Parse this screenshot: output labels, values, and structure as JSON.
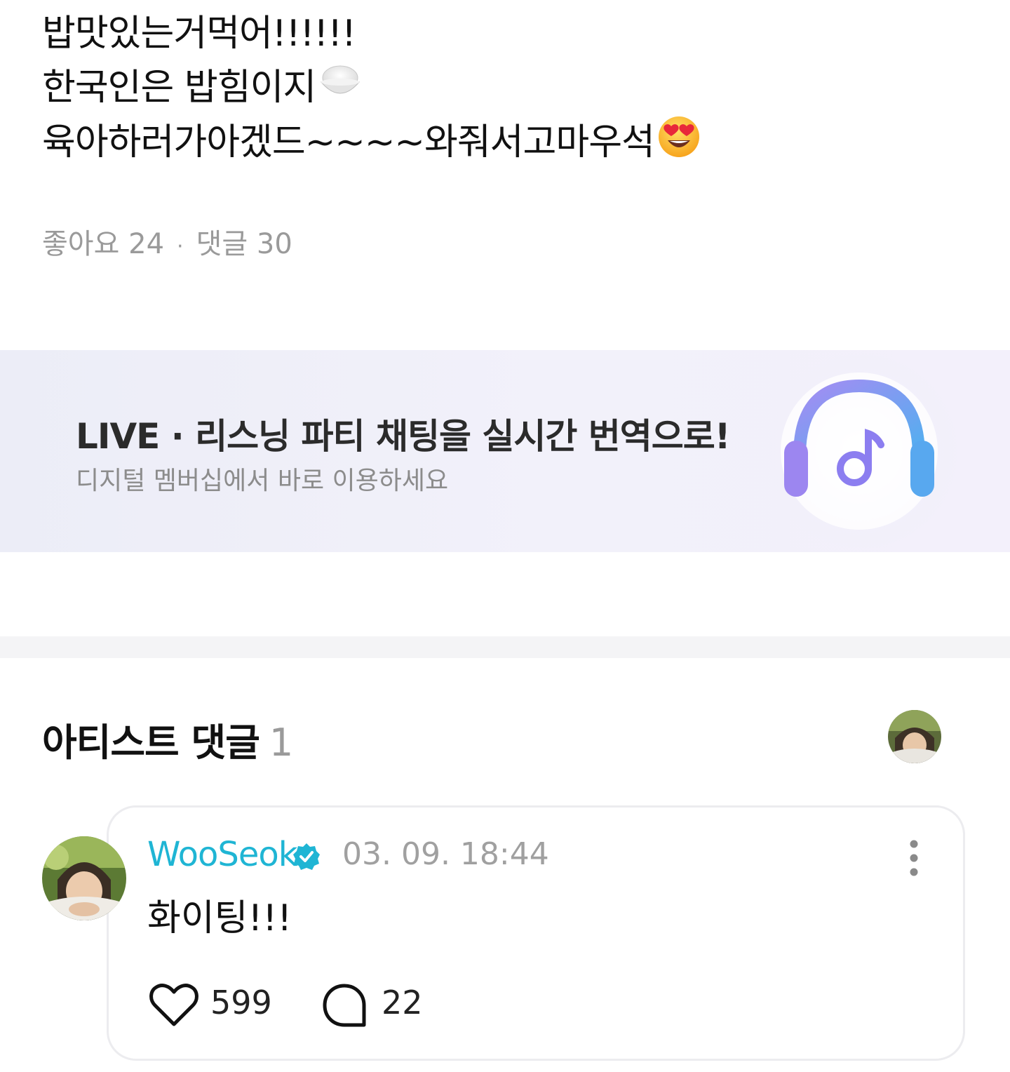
{
  "post": {
    "lines": [
      "밥맛있는거먹어!!!!!!",
      "한국인은 밥힘이지",
      "육아하러가아겠드~~~~와줘서고마우석"
    ],
    "emoji_line2": "rice-bowl-emoji",
    "emoji_line3": "heart-eyes-emoji"
  },
  "stats": {
    "likes_label": "좋아요 24",
    "separator": "·",
    "comments_label": "댓글 30"
  },
  "banner": {
    "title": "LIVE · 리스닝 파티 채팅을 실시간 번역으로!",
    "subtitle": "디지털 멤버십에서 바로 이용하세요",
    "icon": "headphones-music-icon"
  },
  "artist_comments": {
    "title": "아티스트 댓글",
    "count": "1"
  },
  "comment": {
    "author": "WooSeok",
    "timestamp": "03. 09. 18:44",
    "text": "화이팅!!!",
    "likes": "599",
    "replies": "22"
  },
  "colors": {
    "author": "#1fb5d4",
    "muted": "#9a9a9a",
    "banner_bg": "#eeeef8",
    "headphone_purple": "#8f7bf0",
    "headphone_blue": "#5aaef0"
  }
}
